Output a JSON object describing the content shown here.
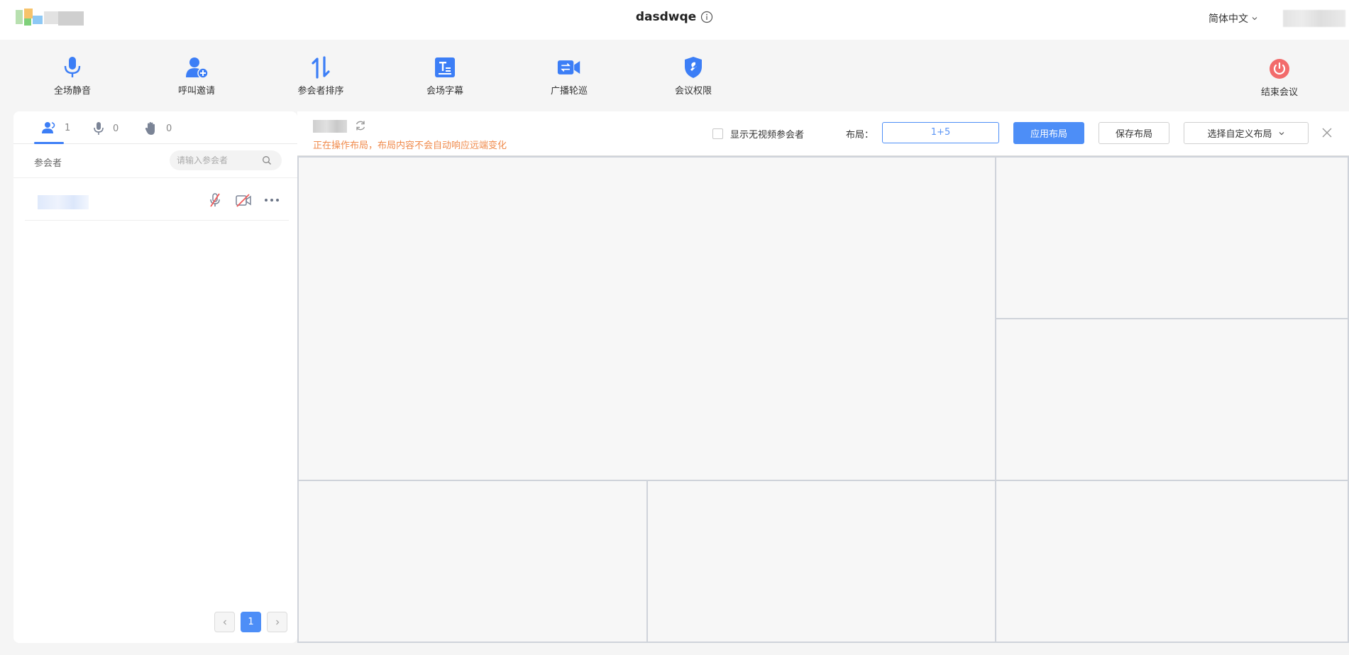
{
  "header": {
    "title": "dasdwqe",
    "language": "简体中文"
  },
  "toolbar": {
    "items": [
      {
        "label": "全场静音",
        "icon": "microphone-icon"
      },
      {
        "label": "呼叫邀请",
        "icon": "add-user-icon"
      },
      {
        "label": "参会者排序",
        "icon": "sort-icon"
      },
      {
        "label": "会场字幕",
        "icon": "subtitle-icon"
      },
      {
        "label": "广播轮巡",
        "icon": "broadcast-icon"
      },
      {
        "label": "会议权限",
        "icon": "shield-wrench-icon"
      }
    ],
    "end_label": "结束会议"
  },
  "left": {
    "tabs": [
      {
        "icon": "participants-icon",
        "count": "1"
      },
      {
        "icon": "microphone-icon",
        "count": "0"
      },
      {
        "icon": "raise-hand-icon",
        "count": "0"
      }
    ],
    "search_label": "参会者",
    "search_placeholder": "请输入参会者",
    "pagination": {
      "current": "1"
    }
  },
  "layout_panel": {
    "warning": "正在操作布局，布局内容不会自动响应远端变化",
    "show_no_video_label": "显示无视频参会者",
    "layout_label": "布局：",
    "layout_value": "1+5",
    "apply_label": "应用布局",
    "save_label": "保存布局",
    "custom_label": "选择自定义布局"
  },
  "colors": {
    "accent": "#4d8ef7",
    "icon_blue": "#3c7ef6",
    "warning": "#f08a4b",
    "end_red": "#f26b6b"
  }
}
